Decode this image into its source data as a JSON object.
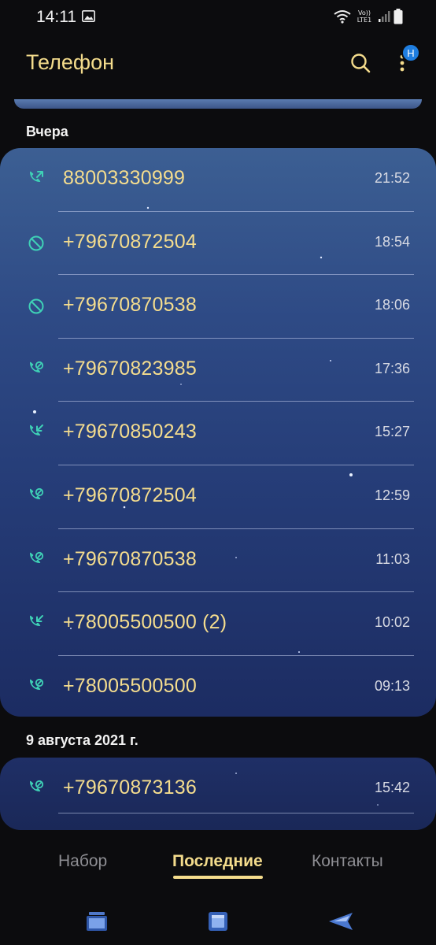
{
  "status_bar": {
    "time": "14:11",
    "network": "Vo)) LTE1"
  },
  "header": {
    "title": "Телефон",
    "badge": "H"
  },
  "sections": [
    {
      "label": "Вчера",
      "calls": [
        {
          "type": "outgoing",
          "number": "88003330999",
          "time": "21:52"
        },
        {
          "type": "blocked",
          "number": "+79670872504",
          "time": "18:54"
        },
        {
          "type": "blocked",
          "number": "+79670870538",
          "time": "18:06"
        },
        {
          "type": "rejected",
          "number": "+79670823985",
          "time": "17:36"
        },
        {
          "type": "incoming",
          "number": "+79670850243",
          "time": "15:27"
        },
        {
          "type": "rejected",
          "number": "+79670872504",
          "time": "12:59"
        },
        {
          "type": "rejected",
          "number": "+79670870538",
          "time": "11:03"
        },
        {
          "type": "incoming",
          "number": "+78005500500 (2)",
          "time": "10:02"
        },
        {
          "type": "rejected",
          "number": "+78005500500",
          "time": "09:13"
        }
      ]
    },
    {
      "label": "9 августа 2021 г.",
      "calls": [
        {
          "type": "rejected",
          "number": "+79670873136",
          "time": "15:42"
        }
      ]
    }
  ],
  "tabs": [
    {
      "label": "Набор",
      "active": false
    },
    {
      "label": "Последние",
      "active": true
    },
    {
      "label": "Контакты",
      "active": false
    }
  ],
  "colors": {
    "accent": "#f4dc8c",
    "call_icon": "#3fd1b6",
    "badge": "#1f7ee0"
  }
}
